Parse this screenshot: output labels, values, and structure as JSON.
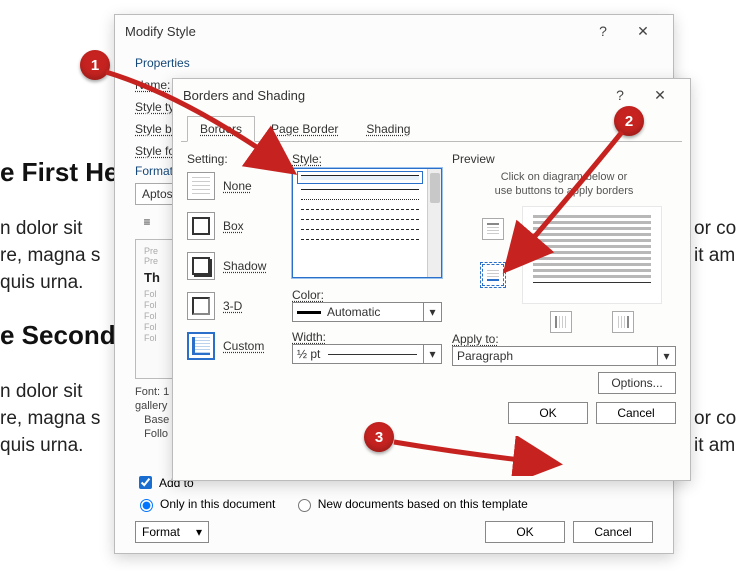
{
  "doc": {
    "h1": "e First He",
    "h2": "e Second",
    "p": "n dolor sit\nre, magna s\nquis urna.",
    "right": "or co\nit am"
  },
  "modifyDlg": {
    "title": "Modify Style",
    "section_props": "Properties",
    "name_label": "Name:",
    "style_type_label": "Style typ",
    "style_based_label": "Style ba",
    "style_following_label": "Style fo",
    "section_fmt": "Formatting",
    "font_name": "Aptos",
    "preview_th": "Th",
    "preview_fol": "Fol",
    "desc": "Font: 1\ngallery\n   Base\n   Follo",
    "add_to": "Add to",
    "only_doc": "Only in this document",
    "new_docs": "New documents based on this template",
    "format_btn": "Format",
    "ok": "OK",
    "cancel": "Cancel"
  },
  "bordersDlg": {
    "title": "Borders and Shading",
    "tabs": {
      "borders": "Borders",
      "page_border": "Page Border",
      "shading": "Shading"
    },
    "setting_label": "Setting:",
    "settings": {
      "none": "None",
      "box": "Box",
      "shadow": "Shadow",
      "3d": "3-D",
      "custom": "Custom"
    },
    "style_label": "Style:",
    "color_label": "Color:",
    "color_value": "Automatic",
    "width_label": "Width:",
    "width_value": "½ pt",
    "preview_label": "Preview",
    "preview_hint": "Click on diagram below or\nuse buttons to apply borders",
    "apply_to_label": "Apply to:",
    "apply_to_value": "Paragraph",
    "options": "Options...",
    "ok": "OK",
    "cancel": "Cancel"
  },
  "callouts": {
    "c1": "1",
    "c2": "2",
    "c3": "3"
  }
}
